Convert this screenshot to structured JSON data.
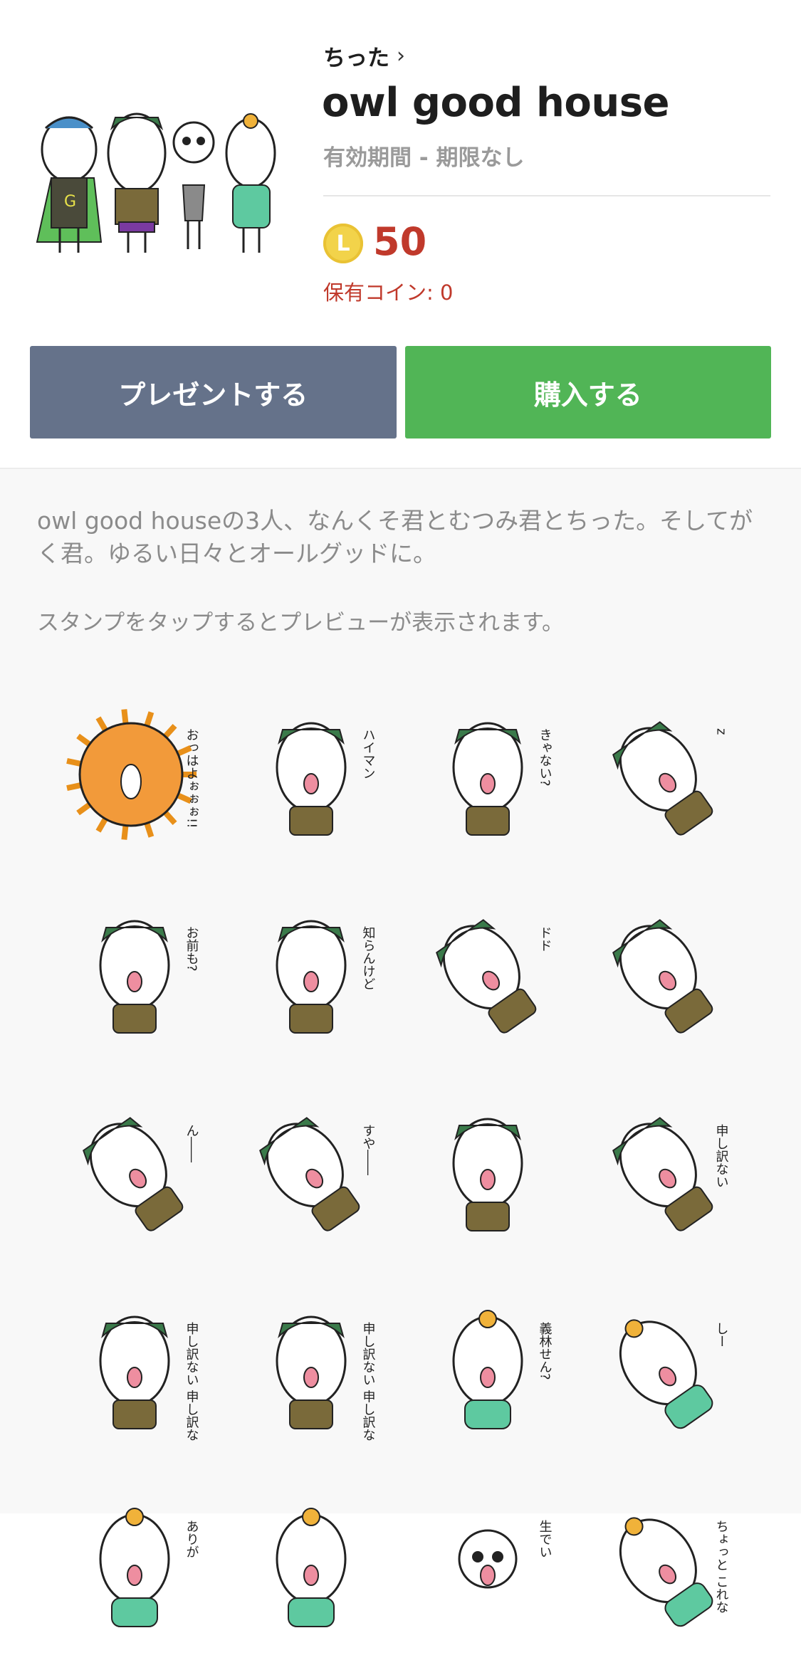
{
  "product": {
    "author": "ちった",
    "author_chevron": "›",
    "title": "owl good house",
    "validity": "有効期間 - 期限なし",
    "coin_letter": "L",
    "price": "50",
    "owned_coins": "保有コイン: 0"
  },
  "actions": {
    "gift_label": "プレゼントする",
    "buy_label": "購入する"
  },
  "description": {
    "text": "owl good houseの3人、なんくそ君とむつみ君とちった。そしてがく君。ゆるい日々とオールグッドに。",
    "hint": "スタンプをタップするとプレビューが表示されます。"
  },
  "stickers": [
    {
      "caption": "おっはよぉぉぉ!!"
    },
    {
      "caption": "ハイマン"
    },
    {
      "caption": "きゃない?"
    },
    {
      "caption": "z"
    },
    {
      "caption": "お前も?"
    },
    {
      "caption": "知らんけど"
    },
    {
      "caption": "ドド"
    },
    {
      "caption": ""
    },
    {
      "caption": "ん――"
    },
    {
      "caption": "すや――"
    },
    {
      "caption": ""
    },
    {
      "caption": "申し訳ない"
    },
    {
      "caption": "申し訳ない 申し訳ない"
    },
    {
      "caption": "申し訳ない 申し訳ない 申し訳ない"
    },
    {
      "caption": "義林せん?"
    },
    {
      "caption": "しー"
    },
    {
      "caption": "ありが"
    },
    {
      "caption": ""
    },
    {
      "caption": "生でい"
    },
    {
      "caption": "ちょっと これな"
    }
  ],
  "colors": {
    "gift_button": "#65728a",
    "buy_button": "#51b556",
    "price": "#c0392b",
    "coin": "#f2d34a"
  }
}
